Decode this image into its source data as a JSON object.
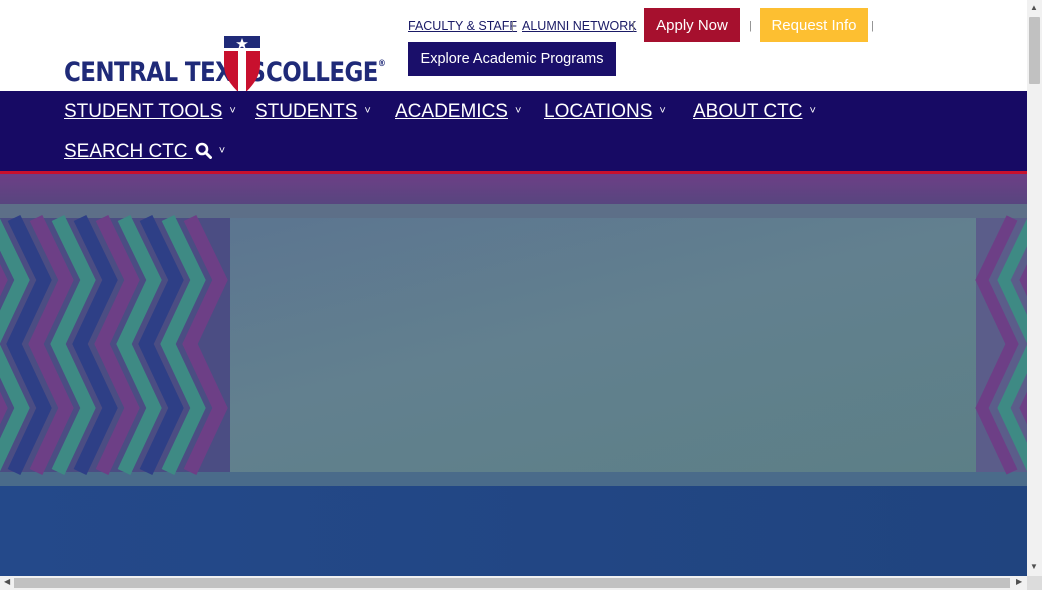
{
  "logo": {
    "text_left": "CENTRAL TEXAS",
    "text_right": "COLLEGE",
    "registered": "®",
    "icon": "star-shield-icon",
    "colors": {
      "navy": "#1f2a78",
      "red": "#c8102e"
    }
  },
  "utility": {
    "faculty_label": "FACULTY & STAFF",
    "alumni_label": "ALUMNI NETWORK",
    "separator": "|",
    "apply_label": "Apply Now",
    "request_label": "Request Info",
    "explore_label": "Explore Academic Programs"
  },
  "nav": {
    "items": [
      {
        "label": "STUDENT TOOLS"
      },
      {
        "label": "STUDENTS"
      },
      {
        "label": "ACADEMICS"
      },
      {
        "label": "LOCATIONS"
      },
      {
        "label": "ABOUT CTC"
      },
      {
        "label": "SEARCH CTC"
      }
    ],
    "chevron": "˅",
    "search_icon": "search-icon"
  },
  "hero": {
    "pattern": "chevron-stripes",
    "colors": {
      "teal": "#3e8a84",
      "purple": "#6d3f86",
      "navy": "#2e3f86",
      "banner": "#5e7d8e",
      "bottom": "#234a86"
    }
  },
  "colors": {
    "nav_background": "#170a64",
    "nav_border": "#c8102e",
    "apply_button": "#a6102e",
    "request_button": "#fdbf31",
    "explore_button": "#1a0f6a"
  }
}
